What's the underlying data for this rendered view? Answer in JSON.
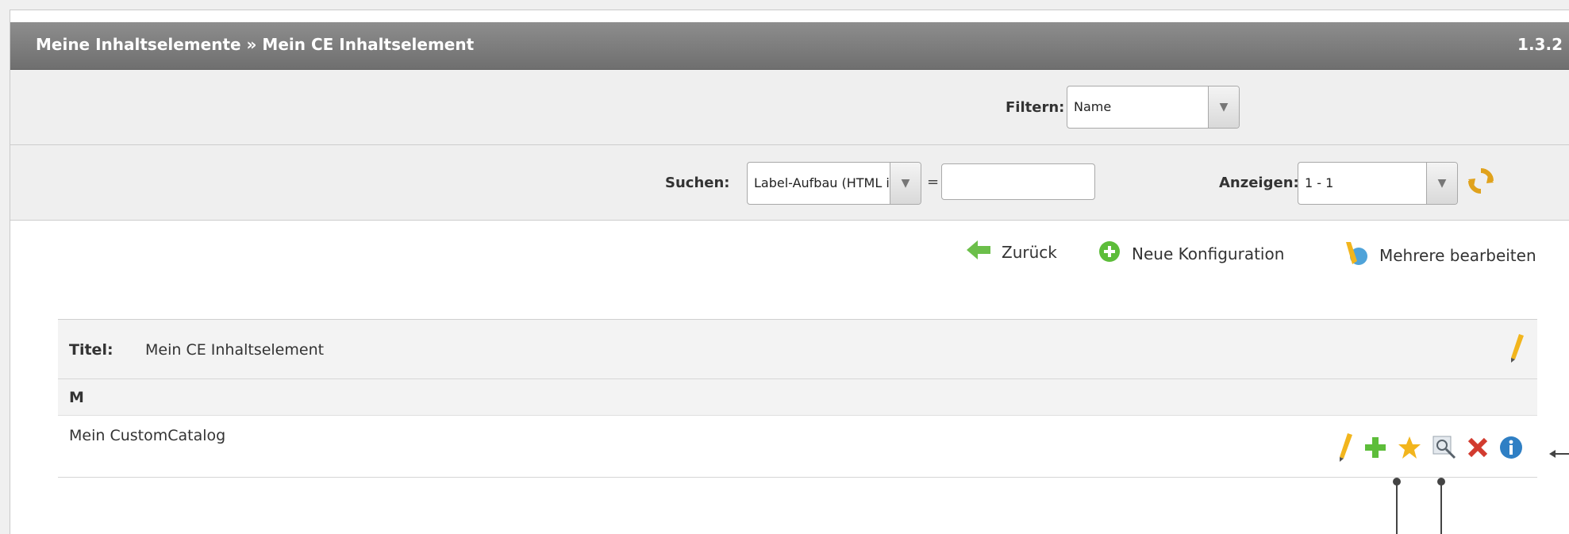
{
  "header": {
    "breadcrumb": "Meine Inhaltselemente » Mein CE Inhaltselement",
    "version": "1.3.2"
  },
  "filter": {
    "label": "Filtern:",
    "value": "Name"
  },
  "search": {
    "label": "Suchen:",
    "field_value": "Label-Aufbau (HTML ist er",
    "operator": "=",
    "input_value": "",
    "show_label": "Anzeigen:",
    "show_value": "1 - 1"
  },
  "actions": {
    "back": "Zurück",
    "new_config": "Neue Konfiguration",
    "edit_multiple": "Mehrere bearbeiten"
  },
  "table": {
    "title_label": "Titel:",
    "title_value": "Mein CE Inhaltselement",
    "group_letter": "M",
    "item_name": "Mein CustomCatalog"
  },
  "colors": {
    "title_gradient_top": "#8d8d8d",
    "title_gradient_bottom": "#6f6f6f",
    "toolbar_bg": "#efefef"
  }
}
